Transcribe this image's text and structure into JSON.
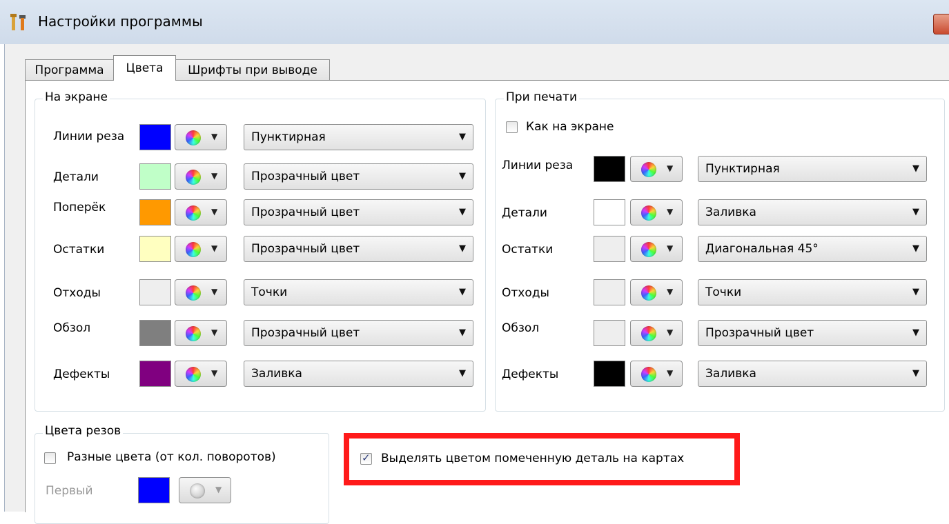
{
  "window": {
    "title": "Настройки программы",
    "icon": "tools-icon"
  },
  "tabs": [
    {
      "label": "Программа",
      "active": false
    },
    {
      "label": "Цвета",
      "active": true
    },
    {
      "label": "Шрифты при выводе",
      "active": false
    }
  ],
  "screen_group": {
    "title": "На экране",
    "rows": [
      {
        "label": "Линии реза",
        "color": "#0000ff",
        "style": "Пунктирная"
      },
      {
        "label": "Детали",
        "color": "#c0ffc8",
        "style": "Прозрачный цвет"
      },
      {
        "label": "Поперёк",
        "color": "#ff9900",
        "style": "Прозрачный цвет"
      },
      {
        "label": "Остатки",
        "color": "#ffffc0",
        "style": "Прозрачный цвет"
      },
      {
        "label": "Отходы",
        "color": "#eeeeee",
        "style": "Точки"
      },
      {
        "label": "Обзол",
        "color": "#7f7f7f",
        "style": "Прозрачный цвет"
      },
      {
        "label": "Дефекты",
        "color": "#800080",
        "style": "Заливка"
      }
    ]
  },
  "print_group": {
    "title": "При печати",
    "same_as_screen": {
      "label": "Как на экране",
      "checked": false
    },
    "rows": [
      {
        "label": "Линии реза",
        "color": "#000000",
        "style": "Пунктирная"
      },
      {
        "label": "Детали",
        "color": "#ffffff",
        "style": "Заливка"
      },
      {
        "label": "Остатки",
        "color": "#eeeeee",
        "style": "Диагональная 45°"
      },
      {
        "label": "Отходы",
        "color": "#eeeeee",
        "style": "Точки"
      },
      {
        "label": "Обзол",
        "color": "#eeeeee",
        "style": "Прозрачный цвет"
      },
      {
        "label": "Дефекты",
        "color": "#000000",
        "style": "Заливка"
      }
    ]
  },
  "cut_colors": {
    "title": "Цвета резов",
    "different": {
      "label": "Разные цвета (от кол. поворотов)",
      "checked": false
    },
    "first": {
      "label": "Первый",
      "color": "#0000ff"
    }
  },
  "highlight_option": {
    "label": "Выделять цветом помеченную деталь на картах",
    "checked": true
  },
  "icons": {
    "color_picker": "color-wheel-icon",
    "dropdown": "chevron-down-icon"
  },
  "accent": {
    "highlight_border": "#ff1a1a"
  }
}
